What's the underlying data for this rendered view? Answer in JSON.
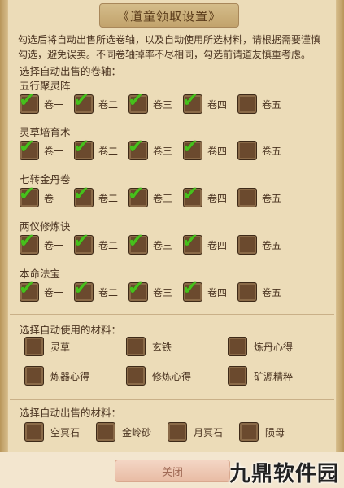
{
  "title": "《道童领取设置》",
  "description": "勾选后将自动出售所选卷轴，以及自动使用所选材料，请根据需要谨慎勾选，避免误卖。不同卷轴掉率不尽相同，勾选前请道友慎重考虑。",
  "scroll_section_title": "选择自动出售的卷轴：",
  "scroll_groups": [
    {
      "name": "五行聚灵阵",
      "options": [
        {
          "label": "卷一",
          "checked": true
        },
        {
          "label": "卷二",
          "checked": true
        },
        {
          "label": "卷三",
          "checked": true
        },
        {
          "label": "卷四",
          "checked": true
        },
        {
          "label": "卷五",
          "checked": false
        }
      ]
    },
    {
      "name": "灵草培育术",
      "options": [
        {
          "label": "卷一",
          "checked": true
        },
        {
          "label": "卷二",
          "checked": true
        },
        {
          "label": "卷三",
          "checked": true
        },
        {
          "label": "卷四",
          "checked": true
        },
        {
          "label": "卷五",
          "checked": false
        }
      ]
    },
    {
      "name": "七转金丹卷",
      "options": [
        {
          "label": "卷一",
          "checked": true
        },
        {
          "label": "卷二",
          "checked": true
        },
        {
          "label": "卷三",
          "checked": true
        },
        {
          "label": "卷四",
          "checked": true
        },
        {
          "label": "卷五",
          "checked": false
        }
      ]
    },
    {
      "name": "两仪修炼诀",
      "options": [
        {
          "label": "卷一",
          "checked": true
        },
        {
          "label": "卷二",
          "checked": true
        },
        {
          "label": "卷三",
          "checked": true
        },
        {
          "label": "卷四",
          "checked": true
        },
        {
          "label": "卷五",
          "checked": false
        }
      ]
    },
    {
      "name": "本命法宝",
      "options": [
        {
          "label": "卷一",
          "checked": true
        },
        {
          "label": "卷二",
          "checked": true
        },
        {
          "label": "卷三",
          "checked": true
        },
        {
          "label": "卷四",
          "checked": true
        },
        {
          "label": "卷五",
          "checked": false
        }
      ]
    }
  ],
  "use_section_title": "选择自动使用的材料：",
  "use_materials": [
    {
      "label": "灵草",
      "checked": false
    },
    {
      "label": "玄铁",
      "checked": false
    },
    {
      "label": "炼丹心得",
      "checked": false
    },
    {
      "label": "炼器心得",
      "checked": false
    },
    {
      "label": "修炼心得",
      "checked": false
    },
    {
      "label": "矿源精粹",
      "checked": false
    }
  ],
  "sell_section_title": "选择自动出售的材料：",
  "sell_materials": [
    {
      "label": "空冥石",
      "checked": false
    },
    {
      "label": "金岭砂",
      "checked": false
    },
    {
      "label": "月冥石",
      "checked": false
    },
    {
      "label": "陨母",
      "checked": false
    }
  ],
  "close_label": "关闭",
  "watermark": "九鼎软件园",
  "colors": {
    "check": "#47c01c",
    "box": "#6b4a2e",
    "panel": "#ecdcb8",
    "text": "#4a3320"
  }
}
